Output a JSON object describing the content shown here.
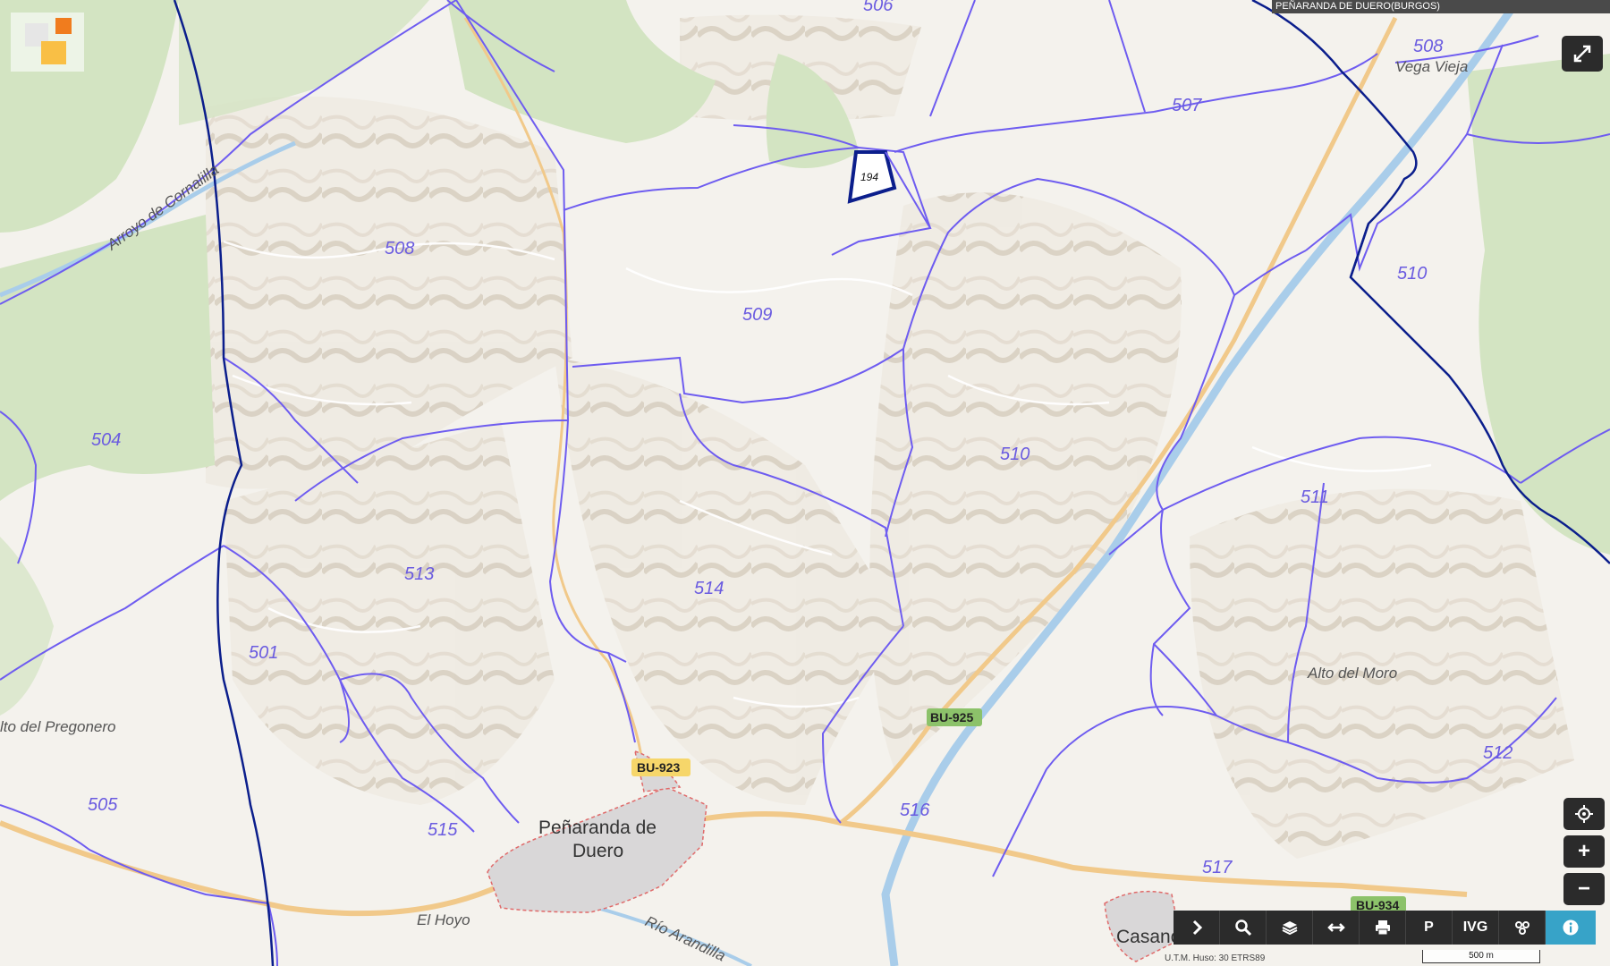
{
  "map": {
    "title": "PEÑARANDA DE DUERO(BURGOS)",
    "polygons": [
      "508",
      "507",
      "508",
      "509",
      "504",
      "510",
      "510",
      "511",
      "513",
      "514",
      "501",
      "505",
      "515",
      "516",
      "517",
      "512"
    ],
    "selected_parcel": "194",
    "top_cut_label": "506",
    "place_names": [
      "Vega Vieja",
      "Arroyo de Cornalilla",
      "Alto del Moro",
      "lto del Pregonero",
      "El Hoyo",
      "Río Arandilla"
    ],
    "towns": [
      "Peñaranda de",
      "Duero",
      "Casanova"
    ],
    "roads": [
      "BU-925",
      "BU-923",
      "BU-934"
    ]
  },
  "controls": {
    "fullscreen_icon": "expand-icon",
    "locate_icon": "crosshair-icon",
    "zoom_in": "+",
    "zoom_out": "−"
  },
  "toolbar": {
    "items": [
      {
        "icon": "chevron-right-icon"
      },
      {
        "icon": "search-icon"
      },
      {
        "icon": "layers-icon"
      },
      {
        "icon": "measure-icon"
      },
      {
        "icon": "print-icon"
      },
      {
        "icon": "parking-icon",
        "label": "P"
      },
      {
        "icon": "ivg-icon",
        "label": "IVG"
      },
      {
        "icon": "satellite-icon"
      },
      {
        "icon": "info-icon"
      }
    ]
  },
  "status": {
    "coords": "U.T.M. Huso: 30 ETRS89",
    "scale": "500 m"
  },
  "colors": {
    "boundary": "#6e5cf0",
    "municipal": "#0b1e8c",
    "road": "#f1c98a",
    "river": "#a9cdea",
    "forest": "#cfe3bd",
    "background": "#f3f1ec"
  }
}
